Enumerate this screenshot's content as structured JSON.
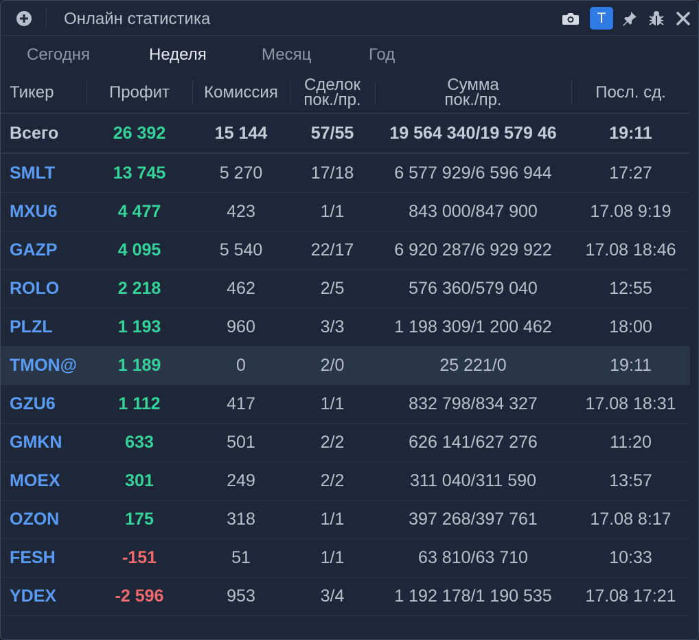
{
  "window": {
    "title": "Онлайн статистика",
    "badge": "T",
    "icons": [
      "add-icon",
      "camera-icon",
      "pin-icon",
      "bug-icon",
      "close-icon"
    ],
    "colors": {
      "accent": "#2f7ae5",
      "positive": "#35d39a",
      "negative": "#f06a6f",
      "ticker": "#5a9cf5"
    }
  },
  "tabs": [
    {
      "label": "Сегодня",
      "active": false
    },
    {
      "label": "Неделя",
      "active": true
    },
    {
      "label": "Месяц",
      "active": false
    },
    {
      "label": "Год",
      "active": false
    }
  ],
  "columns": {
    "ticker": "Тикер",
    "profit": "Профит",
    "commission": "Комиссия",
    "deals_line1": "Сделок",
    "deals_line2": "пок./пр.",
    "sum_line1": "Сумма",
    "sum_line2": "пок./пр.",
    "last": "Посл. сд."
  },
  "total": {
    "ticker": "Всего",
    "profit": "26 392",
    "commission": "15 144",
    "deals": "57/55",
    "sum": "19 564 340/19 579 46",
    "last": "19:11"
  },
  "rows": [
    {
      "ticker": "SMLT",
      "profit": "13 745",
      "commission": "5 270",
      "deals": "17/18",
      "sum": "6 577 929/6 596 944",
      "last": "17:27"
    },
    {
      "ticker": "MXU6",
      "profit": "4 477",
      "commission": "423",
      "deals": "1/1",
      "sum": "843 000/847 900",
      "last": "17.08 9:19"
    },
    {
      "ticker": "GAZP",
      "profit": "4 095",
      "commission": "5 540",
      "deals": "22/17",
      "sum": "6 920 287/6 929 922",
      "last": "17.08 18:46"
    },
    {
      "ticker": "ROLO",
      "profit": "2 218",
      "commission": "462",
      "deals": "2/5",
      "sum": "576 360/579 040",
      "last": "12:55"
    },
    {
      "ticker": "PLZL",
      "profit": "1 193",
      "commission": "960",
      "deals": "3/3",
      "sum": "1 198 309/1 200 462",
      "last": "18:00"
    },
    {
      "ticker": "TMON@",
      "profit": "1 189",
      "commission": "0",
      "deals": "2/0",
      "sum": "25 221/0",
      "last": "19:11"
    },
    {
      "ticker": "GZU6",
      "profit": "1 112",
      "commission": "417",
      "deals": "1/1",
      "sum": "832 798/834 327",
      "last": "17.08 18:31"
    },
    {
      "ticker": "GMKN",
      "profit": "633",
      "commission": "501",
      "deals": "2/2",
      "sum": "626 141/627 276",
      "last": "11:20"
    },
    {
      "ticker": "MOEX",
      "profit": "301",
      "commission": "249",
      "deals": "2/2",
      "sum": "311 040/311 590",
      "last": "13:57"
    },
    {
      "ticker": "OZON",
      "profit": "175",
      "commission": "318",
      "deals": "1/1",
      "sum": "397 268/397 761",
      "last": "17.08 8:17"
    },
    {
      "ticker": "FESH",
      "profit": "-151",
      "commission": "51",
      "deals": "1/1",
      "sum": "63 810/63 710",
      "last": "10:33"
    },
    {
      "ticker": "YDEX",
      "profit": "-2 596",
      "commission": "953",
      "deals": "3/4",
      "sum": "1 192 178/1 190 535",
      "last": "17.08 17:21"
    }
  ]
}
